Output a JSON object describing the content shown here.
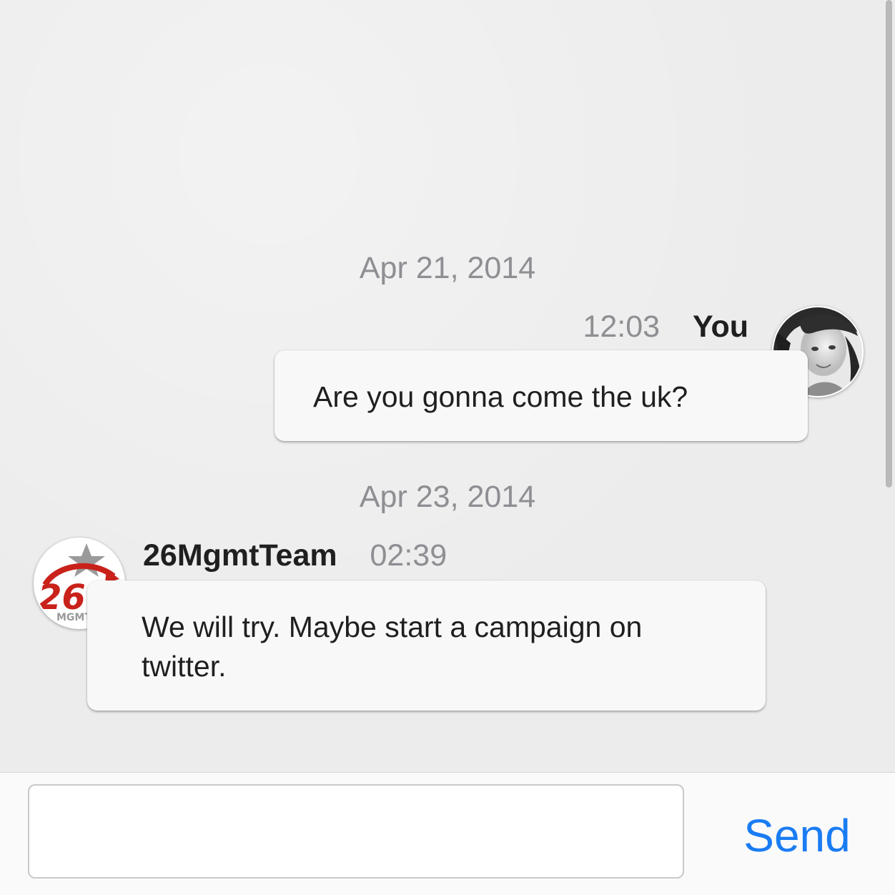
{
  "conversation": {
    "groups": [
      {
        "date": "Apr 21, 2014",
        "message": {
          "time": "12:03",
          "sender": "You",
          "text": "Are you gonna come the uk?"
        }
      },
      {
        "date": "Apr 23, 2014",
        "message": {
          "sender": "26MgmtTeam",
          "time": "02:39",
          "text": "We will try. Maybe start a campaign on twitter."
        }
      }
    ]
  },
  "avatars": {
    "team_logo_text": "MGMT",
    "team_logo_number": "26"
  },
  "composer": {
    "input_value": "",
    "send_label": "Send"
  },
  "colors": {
    "accent": "#1a7cf3",
    "team_red": "#c9221b"
  }
}
